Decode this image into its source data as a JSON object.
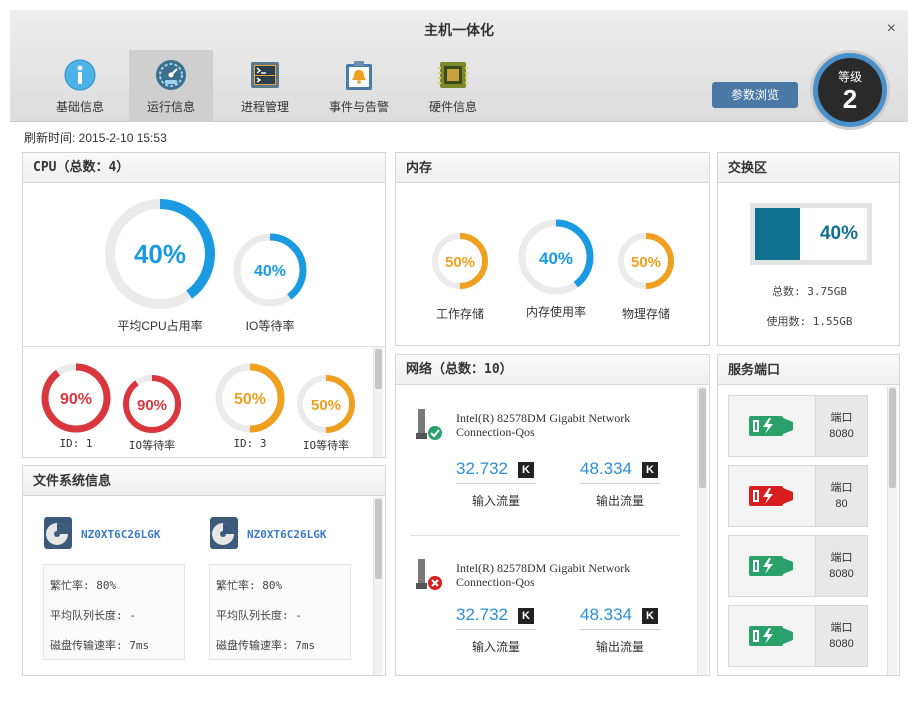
{
  "window": {
    "title": "主机一体化",
    "close": "×"
  },
  "tabs": [
    {
      "label": "基础信息",
      "icon": "info-icon"
    },
    {
      "label": "运行信息",
      "icon": "speedometer-icon"
    },
    {
      "label": "进程管理",
      "icon": "terminal-icon"
    },
    {
      "label": "事件与告警",
      "icon": "alarm-bell-icon"
    },
    {
      "label": "硬件信息",
      "icon": "chip-icon"
    }
  ],
  "active_tab": "运行信息",
  "params_button": "参数浏览",
  "grade": {
    "label": "等级",
    "value": "2"
  },
  "refresh": "刷新时间: 2015-2-10 15:53",
  "cpu": {
    "title": "CPU（总数：4）",
    "avg": {
      "text": "40%",
      "value": 0.4,
      "label": "平均CPU占用率"
    },
    "io": {
      "text": "40%",
      "value": 0.4,
      "label": "IO等待率"
    },
    "cores": [
      {
        "text": "90%",
        "value": 0.9,
        "label": "ID: 1",
        "color": "#d9363e"
      },
      {
        "text": "90%",
        "value": 0.9,
        "label": "IO等待率",
        "color": "#d9363e"
      },
      {
        "text": "50%",
        "value": 0.5,
        "label": "ID: 3",
        "color": "#f0a020"
      },
      {
        "text": "50%",
        "value": 0.5,
        "label": "IO等待率",
        "color": "#f0a020"
      }
    ]
  },
  "memory": {
    "title": "内存",
    "gauges": [
      {
        "text": "50%",
        "value": 0.5,
        "label": "工作存储",
        "color": "#f0a020"
      },
      {
        "text": "40%",
        "value": 0.4,
        "label": "内存使用率",
        "color": "#1a9ae0"
      },
      {
        "text": "50%",
        "value": 0.5,
        "label": "物理存储",
        "color": "#f0a020"
      }
    ]
  },
  "swap": {
    "title": "交换区",
    "text": "40%",
    "value": 0.4,
    "total": "总数: 3.75GB",
    "used": "使用数: 1.55GB"
  },
  "filesystem": {
    "title": "文件系统信息",
    "disks": [
      {
        "name": "NZ0XT6C26LGK",
        "busy": "繁忙率: 80%",
        "queue": "平均队列长度: -",
        "speed": "磁盘传输速率: 7ms"
      },
      {
        "name": "NZ0XT6C26LGK",
        "busy": "繁忙率: 80%",
        "queue": "平均队列长度: -",
        "speed": "磁盘传输速率: 7ms"
      }
    ]
  },
  "network": {
    "title": "网络（总数：10）",
    "adapters": [
      {
        "name1": "Intel(R) 82578DM Gigabit Network",
        "name2": "Connection-Qos",
        "status": "ok",
        "in_val": "32.732",
        "in_unit": "K",
        "in_label": "输入流量",
        "out_val": "48.334",
        "out_unit": "K",
        "out_label": "输出流量"
      },
      {
        "name1": "Intel(R) 82578DM Gigabit Network",
        "name2": "Connection-Qos",
        "status": "error",
        "in_val": "32.732",
        "in_unit": "K",
        "in_label": "输入流量",
        "out_val": "48.334",
        "out_unit": "K",
        "out_label": "输出流量"
      }
    ]
  },
  "ports": {
    "title": "服务端口",
    "items": [
      {
        "label": "端口",
        "number": "8080",
        "color": "#2aa06a"
      },
      {
        "label": "端口",
        "number": "80",
        "color": "#d81e1e"
      },
      {
        "label": "端口",
        "number": "8080",
        "color": "#2aa06a"
      },
      {
        "label": "端口",
        "number": "8080",
        "color": "#2aa06a"
      }
    ]
  },
  "colors": {
    "accent_blue": "#1a9ae0",
    "track": "#ebebeb",
    "swap_fill": "#10708f",
    "header_button": "#4a79a6"
  }
}
